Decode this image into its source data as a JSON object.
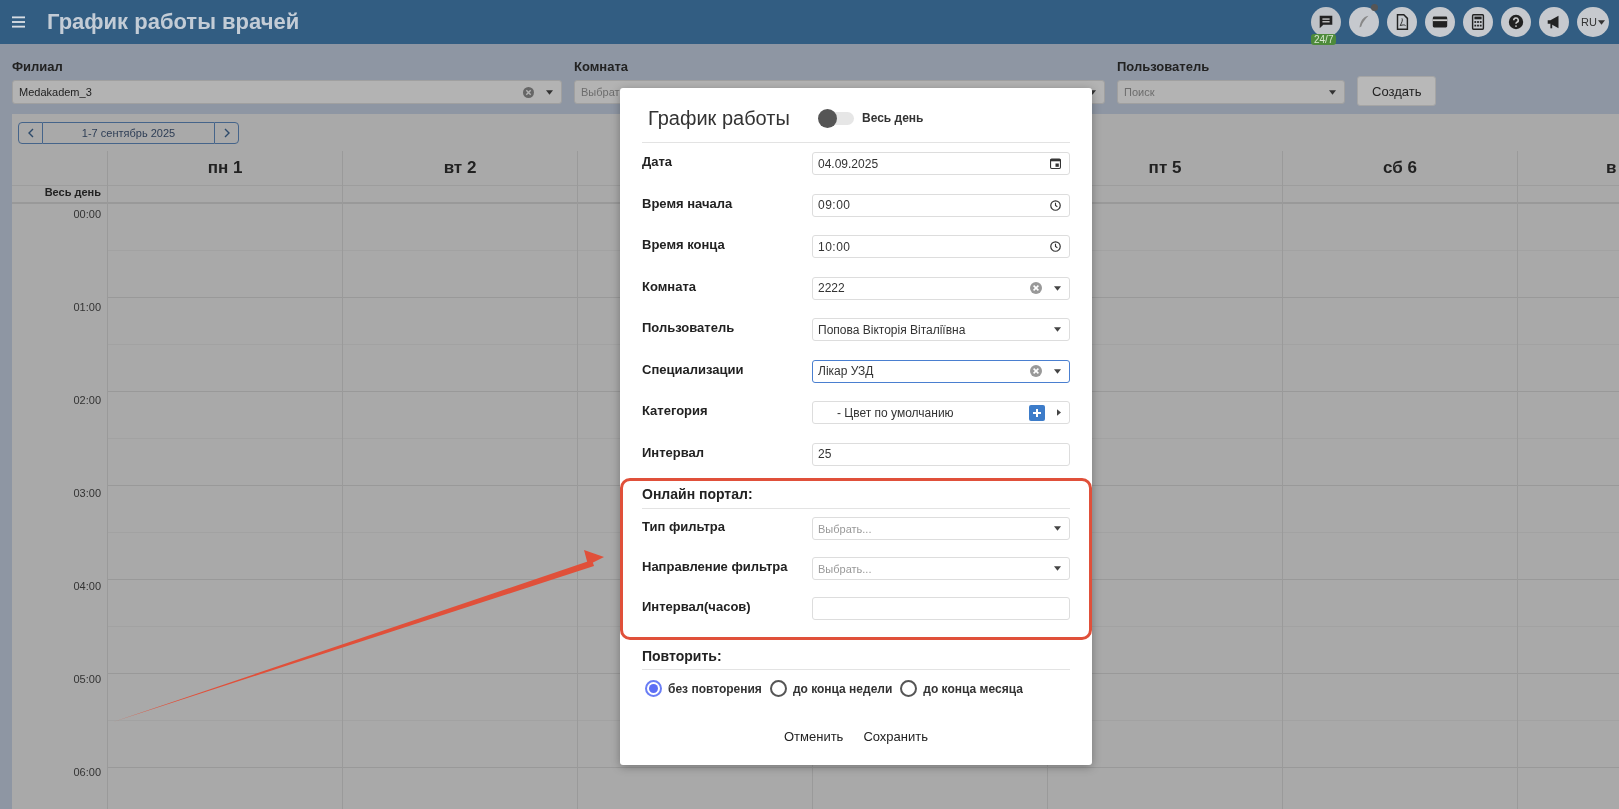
{
  "header": {
    "title": "График работы врачей",
    "chat_badge": "24/7",
    "language": "RU"
  },
  "filters": [
    {
      "label": "Филиал",
      "value": "Medakadem_3",
      "clearable": true
    },
    {
      "label": "Комната",
      "placeholder": "Выбрат"
    },
    {
      "label": "Пользователь",
      "placeholder": "Поиск",
      "clearable": false
    }
  ],
  "create_button": "Создать",
  "week": {
    "range": "1-7 сентябрь 2025"
  },
  "calendar": {
    "all_day": "Весь день",
    "days": [
      {
        "label": "пн 1"
      },
      {
        "label": "вт 2"
      },
      {
        "label": "пт 5"
      },
      {
        "label": "сб 6"
      },
      {
        "label": "в"
      }
    ],
    "times": [
      "00:00",
      "01:00",
      "02:00",
      "03:00",
      "04:00",
      "05:00",
      "06:00"
    ]
  },
  "dialog": {
    "title": "График работы",
    "all_day": {
      "label": "Весь день",
      "on": false
    },
    "fields": [
      {
        "label": "Дата",
        "kind": "date",
        "value": "04.09.2025",
        "focused": false
      },
      {
        "label": "Время начала",
        "kind": "time",
        "value": "09:00",
        "focused": false
      },
      {
        "label": "Время конца",
        "kind": "time",
        "value": "10:00",
        "focused": false
      },
      {
        "label": "Комната",
        "kind": "select",
        "value": "2222",
        "clearable": true,
        "focused": false
      },
      {
        "label": "Пользователь",
        "kind": "select",
        "value": "Попова Вікторія Віталіївна",
        "clearable": false,
        "focused": false
      },
      {
        "label": "Специализации",
        "kind": "select",
        "value": "Лікар УЗД",
        "clearable": true,
        "focused": true
      },
      {
        "label": "Категория",
        "kind": "category",
        "value": "- Цвет по умолчанию",
        "focused": false
      },
      {
        "label": "Интервал",
        "kind": "text",
        "value": "25",
        "focused": false
      }
    ],
    "online": {
      "title": "Онлайн портал:",
      "fields": [
        {
          "label": "Тип фильтра",
          "kind": "select",
          "placeholder": "Выбрать...",
          "clearable": false,
          "focused": false
        },
        {
          "label": "Направление фильтра",
          "kind": "select",
          "placeholder": "Выбрать...",
          "clearable": false,
          "focused": false
        },
        {
          "label": "Интервал(часов)",
          "kind": "text",
          "focused": false
        }
      ]
    },
    "repeat": {
      "title": "Повторить:",
      "options": [
        {
          "label": "без повторения",
          "selected": true
        },
        {
          "label": "до конца недели",
          "selected": false
        },
        {
          "label": "до конца месяца",
          "selected": false
        }
      ]
    },
    "buttons": [
      "Отменить",
      "Сохранить"
    ]
  }
}
